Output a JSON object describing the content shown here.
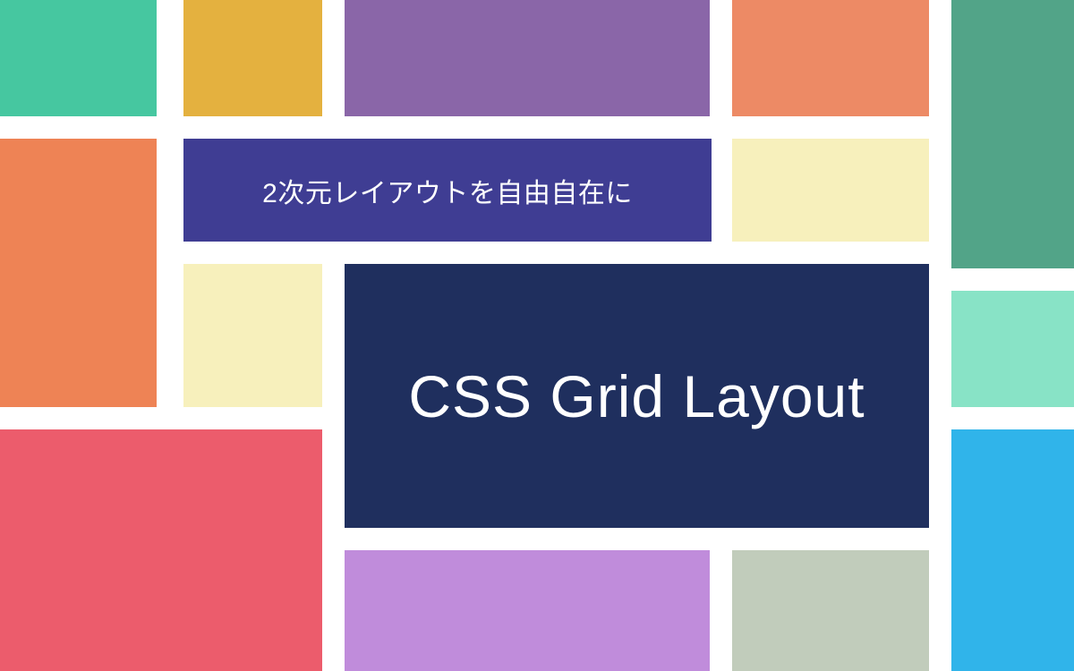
{
  "subtitle": "2次元レイアウトを自由自在に",
  "title": "CSS Grid Layout",
  "colors": {
    "teal": "#46c7a0",
    "yellow": "#e4b13f",
    "purple": "#8a66a8",
    "orange_light": "#ed8a65",
    "green_dark": "#52a488",
    "orange": "#ee8355",
    "indigo": "#3f3d93",
    "cream": "#f7f0bc",
    "navy": "#1f2f5e",
    "mint": "#88e3c6",
    "pink": "#ec5c6c",
    "lilac": "#c08cdb",
    "sage": "#c1ccbb",
    "blue": "#30b4ea"
  }
}
